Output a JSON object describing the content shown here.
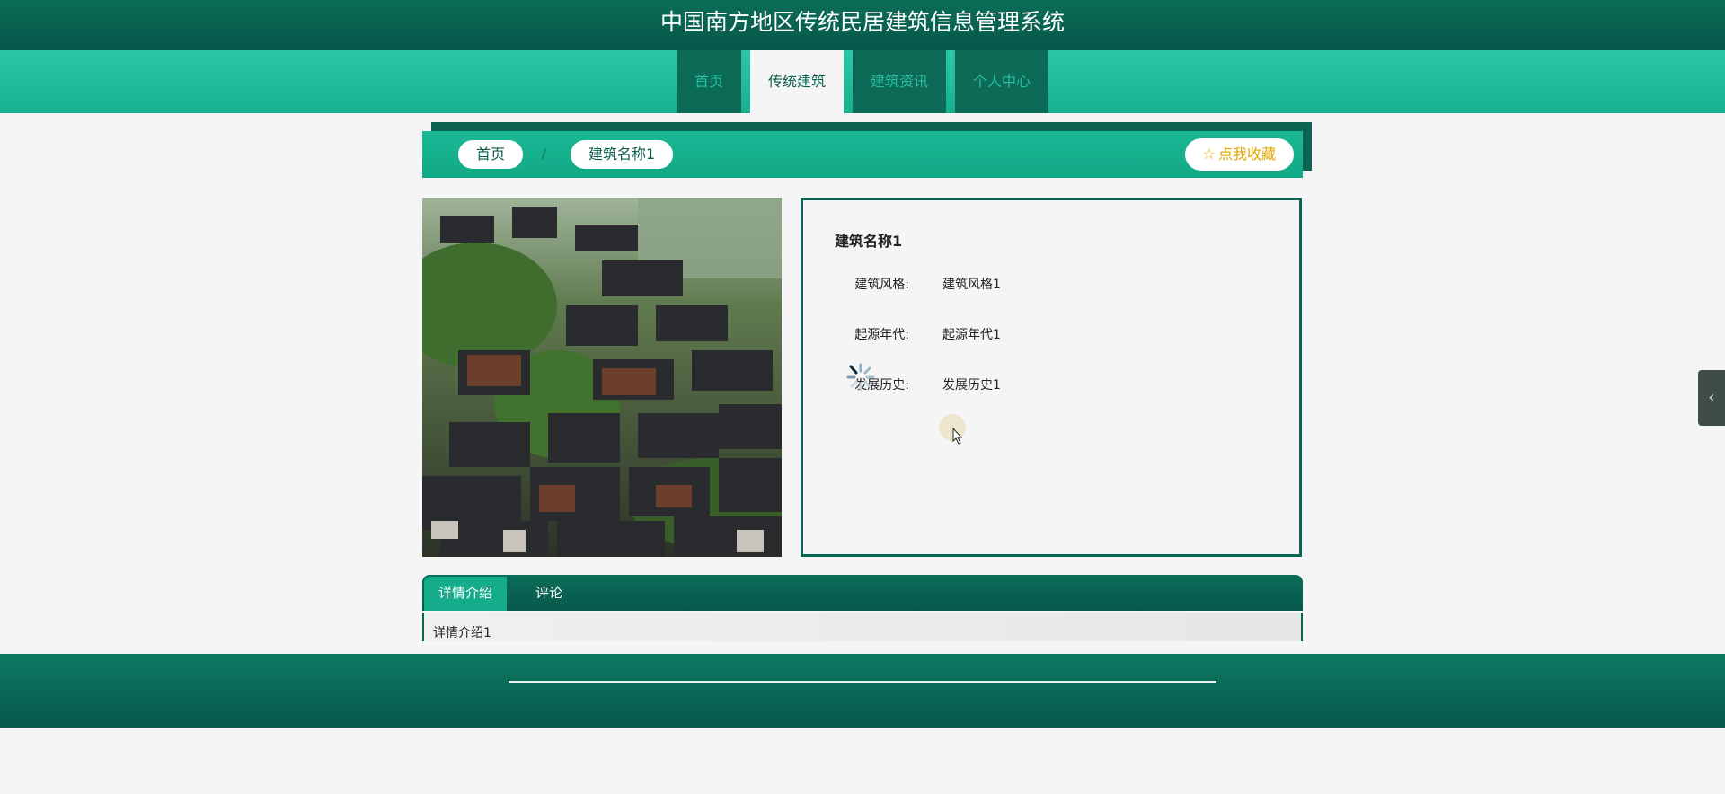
{
  "header": {
    "title": "中国南方地区传统民居建筑信息管理系统"
  },
  "nav": {
    "items": [
      {
        "label": "首页",
        "active": false
      },
      {
        "label": "传统建筑",
        "active": true
      },
      {
        "label": "建筑资讯",
        "active": false
      },
      {
        "label": "个人中心",
        "active": false
      }
    ]
  },
  "breadcrumb": {
    "home": "首页",
    "current": "建筑名称1",
    "separator": "/"
  },
  "favorite": {
    "icon": "star-icon",
    "label": "点我收藏"
  },
  "detail": {
    "name": "建筑名称1",
    "fields": [
      {
        "label": "建筑风格:",
        "value": "建筑风格1"
      },
      {
        "label": "起源年代:",
        "value": "起源年代1"
      },
      {
        "label": "发展历史:",
        "value": "发展历史1"
      }
    ]
  },
  "tabs": {
    "items": [
      {
        "label": "详情介绍",
        "active": true
      },
      {
        "label": "评论",
        "active": false
      }
    ],
    "content": "详情介绍1"
  },
  "side_handle": {
    "icon": "chevron-left-icon"
  },
  "colors": {
    "primary_dark": "#0a6654",
    "primary": "#17b08f",
    "accent_gold": "#e0a800"
  }
}
